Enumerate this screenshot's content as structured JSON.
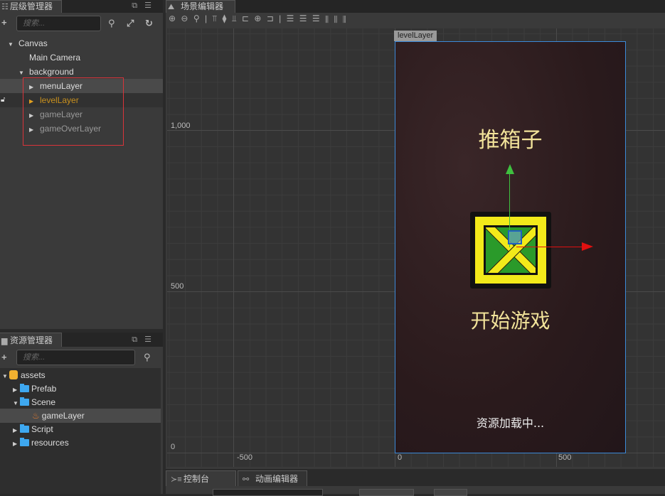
{
  "hierarchy": {
    "title": "层级管理器",
    "search_placeholder": "搜索...",
    "nodes": [
      {
        "label": "Canvas"
      },
      {
        "label": "Main Camera"
      },
      {
        "label": "background"
      },
      {
        "label": "menuLayer"
      },
      {
        "label": "levelLayer"
      },
      {
        "label": "gameLayer"
      },
      {
        "label": "gameOverLayer"
      }
    ]
  },
  "assets": {
    "title": "资源管理器",
    "search_placeholder": "搜索...",
    "items": [
      {
        "label": "assets"
      },
      {
        "label": "Prefab"
      },
      {
        "label": "Scene"
      },
      {
        "label": "gameLayer"
      },
      {
        "label": "Script"
      },
      {
        "label": "resources"
      }
    ]
  },
  "scene": {
    "title": "场景编辑器",
    "node_label": "levelLayer",
    "y_axis": [
      "1,000",
      "500",
      "0"
    ],
    "x_axis": [
      "-500",
      "0",
      "500"
    ],
    "game_title": "推箱子",
    "start_label": "开始游戏",
    "loading_text": "资源加载中..."
  },
  "bottom": {
    "tabs": [
      {
        "label": "控制台"
      },
      {
        "label": "动画编辑器"
      }
    ]
  },
  "colors": {
    "selection_box": "#d9343a",
    "active_node": "#c8901e",
    "design_border": "#3b8ad9",
    "game_text": "#f2e39a"
  }
}
